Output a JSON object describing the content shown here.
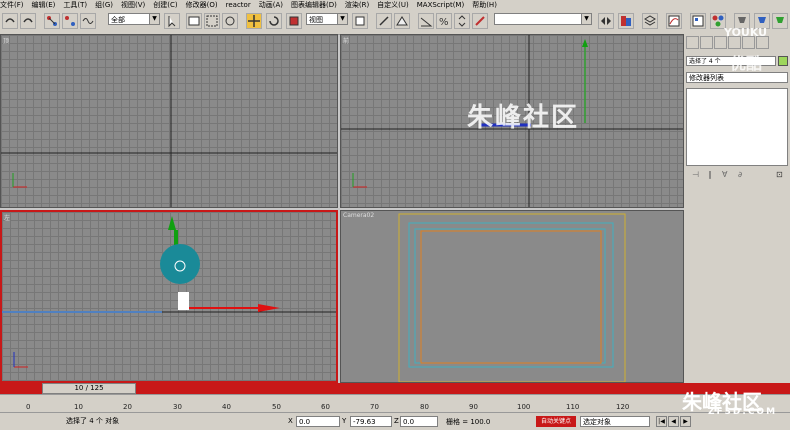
{
  "menu": [
    "文件(F)",
    "编辑(E)",
    "工具(T)",
    "组(G)",
    "视图(V)",
    "创建(C)",
    "修改器(O)",
    "reactor",
    "动画(A)",
    "图表编辑器(D)",
    "渲染(R)",
    "自定义(U)",
    "MAXScript(M)",
    "帮助(H)"
  ],
  "toolbar": {
    "selection_filter": "全部",
    "ref_coord": "视图",
    "named_selection": ""
  },
  "viewports": {
    "top_label": "顶",
    "front_label": "前",
    "left_label": "左",
    "camera_label": "Camera02"
  },
  "command_panel": {
    "object_name": "选择了 4 个",
    "modifier_list": "修改器列表",
    "swatch_color": "#9dd65c"
  },
  "timeline": {
    "frame_counter": "10 / 125",
    "ticks": [
      "0",
      "10",
      "20",
      "30",
      "40",
      "50",
      "60",
      "70",
      "80",
      "90",
      "100",
      "110",
      "120"
    ]
  },
  "status": {
    "selection_text": "选择了 4 个 对象",
    "x_label": "X",
    "x_value": "0.0",
    "y_label": "Y",
    "y_value": "-79.63",
    "z_label": "Z",
    "z_value": "0.0",
    "grid": "栅格 = 100.0",
    "autokey": "自动关键点",
    "key_filter": "选定对象"
  },
  "watermarks": {
    "youku": "YOUKU",
    "youku_cn": "优酷",
    "viewport_text": "朱峰社区",
    "brand": "朱峰社区",
    "brand_url": "ZF3D.COM"
  },
  "colors": {
    "accent_red": "#c81818",
    "active_tool": "#f0c040",
    "teal": "#1a8a98",
    "gizmo_green": "#10a010",
    "gizmo_red": "#e01010"
  }
}
